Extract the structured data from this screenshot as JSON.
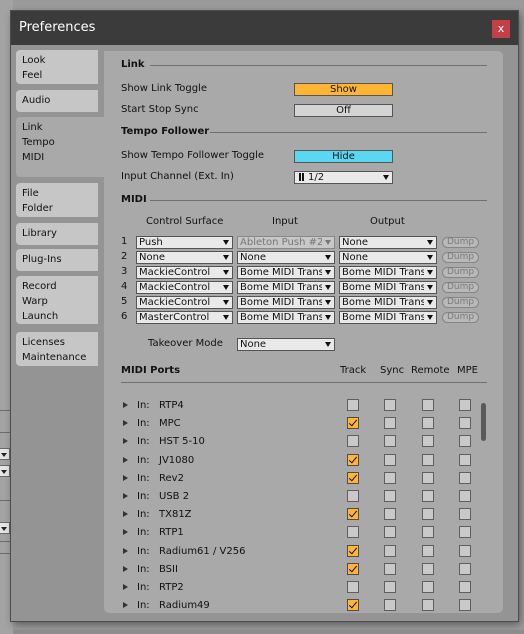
{
  "window": {
    "title": "Preferences",
    "close_label": "x"
  },
  "sidebar": {
    "tabs": [
      {
        "lines": [
          "Look",
          "Feel"
        ]
      },
      {
        "lines": [
          "Audio"
        ]
      },
      {
        "lines": [
          "Link",
          "Tempo",
          "MIDI"
        ],
        "active": true
      },
      {
        "lines": [
          "File",
          "Folder"
        ]
      },
      {
        "lines": [
          "Library"
        ]
      },
      {
        "lines": [
          "Plug-Ins"
        ]
      },
      {
        "lines": [
          "Record",
          "Warp",
          "Launch"
        ]
      },
      {
        "lines": [
          "Licenses",
          "Maintenance"
        ]
      }
    ]
  },
  "link": {
    "title": "Link",
    "show_link_toggle_label": "Show Link Toggle",
    "show_link_toggle_value": "Show",
    "start_stop_sync_label": "Start Stop Sync",
    "start_stop_sync_value": "Off"
  },
  "tempo_follower": {
    "title": "Tempo Follower",
    "show_toggle_label": "Show Tempo Follower Toggle",
    "show_toggle_value": "Hide",
    "input_channel_label": "Input Channel (Ext. In)",
    "input_channel_value": "1/2"
  },
  "midi": {
    "title": "MIDI",
    "col_control_surface": "Control Surface",
    "col_input": "Input",
    "col_output": "Output",
    "dump_label": "Dump",
    "rows": [
      {
        "num": "1",
        "surface": "Push",
        "input": "Ableton Push #2",
        "input_disabled": true,
        "output": "None"
      },
      {
        "num": "2",
        "surface": "None",
        "input": "None",
        "output": "None"
      },
      {
        "num": "3",
        "surface": "MackieControl",
        "input": "Bome MIDI Transla",
        "output": "Bome MIDI Transla"
      },
      {
        "num": "4",
        "surface": "MackieControl",
        "input": "Bome MIDI Transla",
        "output": "Bome MIDI Transla"
      },
      {
        "num": "5",
        "surface": "MackieControl",
        "input": "Bome MIDI Transla",
        "output": "Bome MIDI Transla"
      },
      {
        "num": "6",
        "surface": "MasterControl",
        "input": "Bome MIDI Transla",
        "output": "Bome MIDI Transla"
      }
    ],
    "takeover_label": "Takeover Mode",
    "takeover_value": "None"
  },
  "midi_ports": {
    "title": "MIDI Ports",
    "col_track": "Track",
    "col_sync": "Sync",
    "col_remote": "Remote",
    "col_mpe": "MPE",
    "in_label": "In:",
    "ports": [
      {
        "name": "RTP4",
        "track": false
      },
      {
        "name": "MPC",
        "track": true
      },
      {
        "name": "HST 5-10",
        "track": false
      },
      {
        "name": "JV1080",
        "track": true
      },
      {
        "name": "Rev2",
        "track": true
      },
      {
        "name": "USB 2",
        "track": false
      },
      {
        "name": "TX81Z",
        "track": true
      },
      {
        "name": "RTP1",
        "track": false
      },
      {
        "name": "Radium61 / V256",
        "track": true
      },
      {
        "name": "BSII",
        "track": true
      },
      {
        "name": "RTP2",
        "track": false
      },
      {
        "name": "Radium49",
        "track": true
      }
    ]
  },
  "colors": {
    "accent_orange": "#ffb532",
    "accent_cyan": "#5ad8f2",
    "close_red": "#c44047"
  }
}
